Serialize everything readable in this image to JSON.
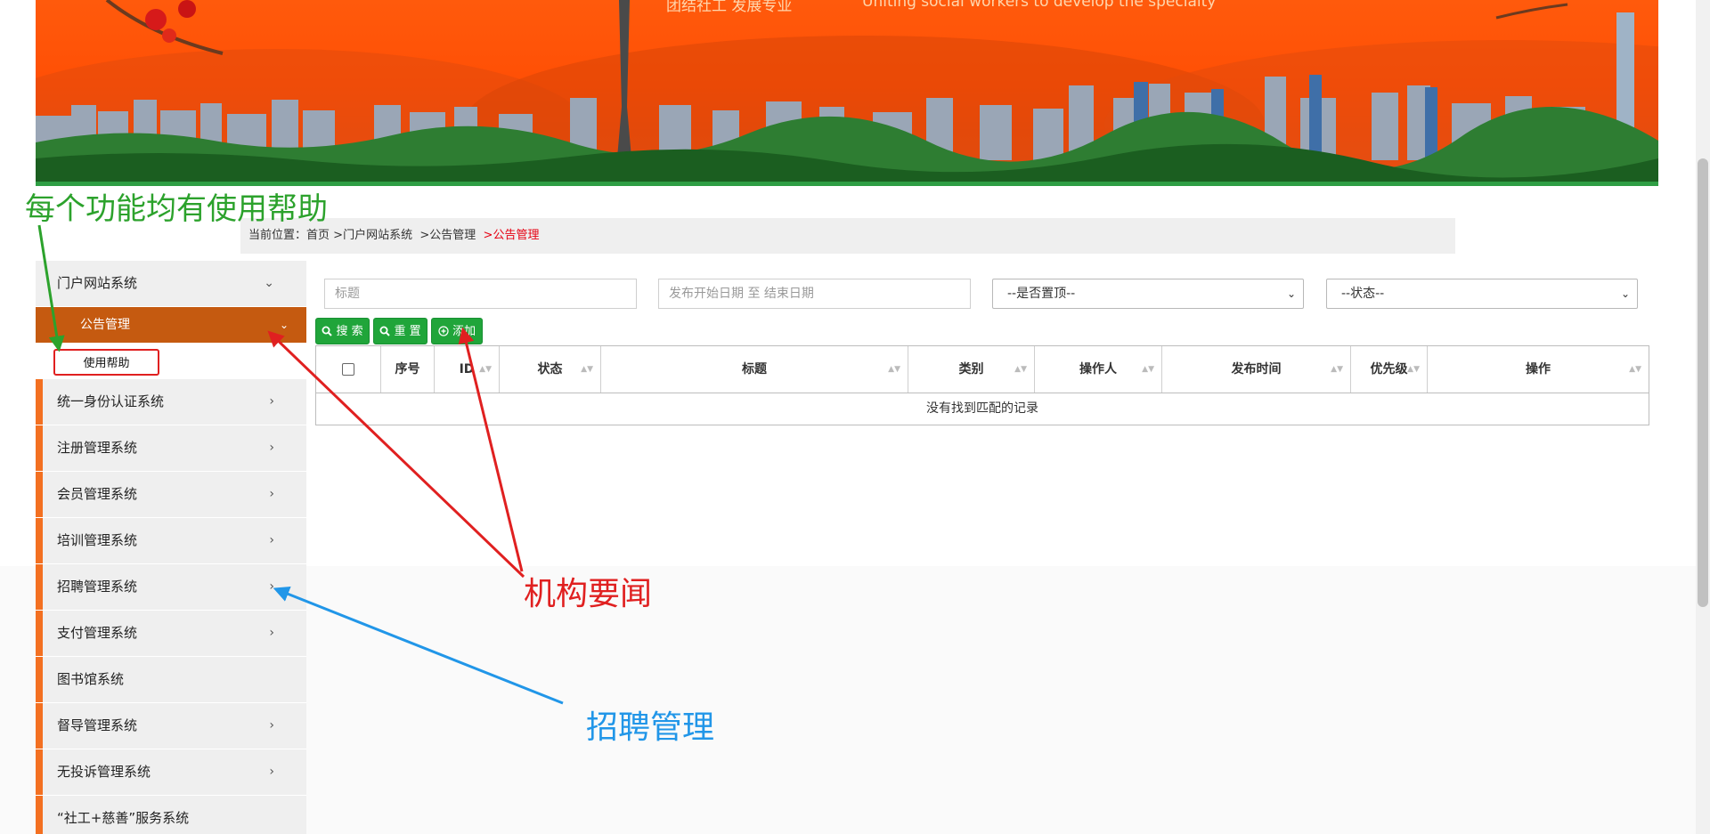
{
  "banner": {
    "tagline_cn": "团结社工 发展专业",
    "tagline_en": "Uniting social workers to develop the specialty"
  },
  "breadcrumb": {
    "prefix": "当前位置：",
    "home": "首页",
    "sep1": " >",
    "level1": "门户网站系统",
    "sep2": " >",
    "level2": "公告管理",
    "sep3": " >",
    "current": "公告管理"
  },
  "sidebar": {
    "items": [
      {
        "label": "门户网站系统",
        "chevron": "down"
      },
      {
        "label": "统一身份认证系统",
        "chevron": "right"
      },
      {
        "label": "注册管理系统",
        "chevron": "right"
      },
      {
        "label": "会员管理系统",
        "chevron": "right"
      },
      {
        "label": "培训管理系统",
        "chevron": "right"
      },
      {
        "label": "招聘管理系统",
        "chevron": "right"
      },
      {
        "label": "支付管理系统",
        "chevron": "right"
      },
      {
        "label": "图书馆系统",
        "chevron": ""
      },
      {
        "label": "督导管理系统",
        "chevron": "right"
      },
      {
        "label": "无投诉管理系统",
        "chevron": "right"
      },
      {
        "label": "“社工+慈善”服务系统",
        "chevron": ""
      }
    ],
    "submenu": {
      "label": "公告管理",
      "leaf": "使用帮助"
    },
    "chevron_down": "⌄",
    "chevron_right": "›"
  },
  "filters": {
    "title_placeholder": "标题",
    "date_placeholder": "发布开始日期 至 结束日期",
    "top_select": "--是否置顶--",
    "status_select": "--状态--",
    "caret": "⌄"
  },
  "buttons": {
    "search": "搜 索",
    "reset": "重 置",
    "add": "添加"
  },
  "table": {
    "columns": [
      "序号",
      "ID",
      "状态",
      "标题",
      "类别",
      "操作人",
      "发布时间",
      "优先级",
      "操作"
    ],
    "sort_glyph": "▲▼",
    "empty_text": "没有找到匹配的记录"
  },
  "annotations": {
    "green": "每个功能均有使用帮助",
    "red": "机构要闻",
    "blue": "招聘管理"
  },
  "colors": {
    "accent_orange": "#f37021",
    "submenu_bg": "#c55a10",
    "button_green": "#20a53a",
    "annotation_red": "#e02020",
    "annotation_green": "#2ca22c",
    "annotation_blue": "#2196e8"
  }
}
